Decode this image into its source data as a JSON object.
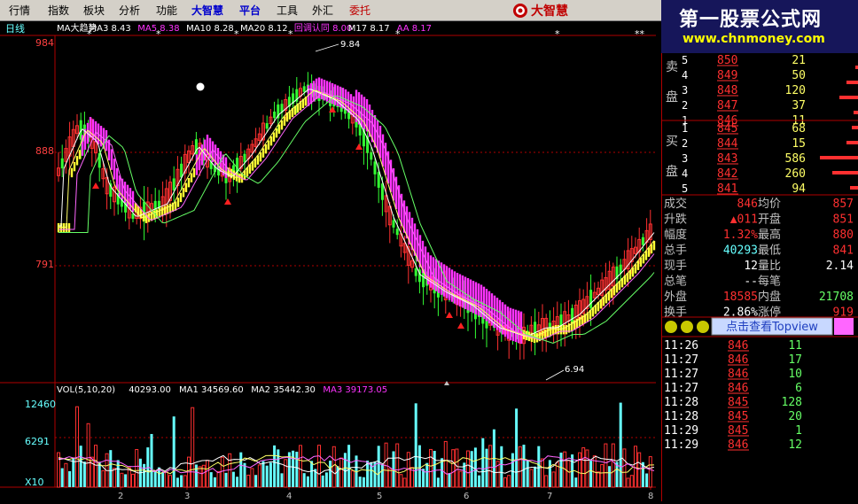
{
  "menu": {
    "items": [
      "行情",
      "指数",
      "板块",
      "分析",
      "功能",
      "大智慧",
      "平台",
      "工具",
      "外汇",
      "委托"
    ],
    "logo_text": "大智慧"
  },
  "banner": {
    "title": "第一股票公式网",
    "url": "www.chnmoney.com"
  },
  "chart": {
    "period_label": "日线",
    "indicator_line": [
      "MA大趋势",
      "MA3 8.43",
      "MA5 8.38",
      "MA10 8.28",
      "MA20 8.12",
      "回调认同 8.00",
      "M17 8.17",
      "AA 8.17"
    ],
    "price_ticks": [
      "984",
      "888",
      "791"
    ],
    "high_label": "9.84",
    "low_label": "6.94",
    "volume_line": [
      "VOL(5,10,20)",
      "40293.00",
      "MA1 34569.60",
      "MA2 35442.30",
      "MA3 39173.05"
    ],
    "volume_ticks": [
      "12460",
      "6291",
      "X10"
    ],
    "x_labels": [
      "2",
      "3",
      "4",
      "5",
      "6",
      "7",
      "8"
    ],
    "colors": {
      "up": "#ff3030",
      "down": "#33ff33",
      "magenta": "#ff33ff",
      "yellow": "#ffff33",
      "grid": "#b00000"
    }
  },
  "order_book": {
    "sell_label": [
      "卖",
      "盘"
    ],
    "buy_label": [
      "买",
      "盘"
    ],
    "sell": [
      {
        "level": "5",
        "price": "850",
        "vol": "21"
      },
      {
        "level": "4",
        "price": "849",
        "vol": "50"
      },
      {
        "level": "3",
        "price": "848",
        "vol": "120"
      },
      {
        "level": "2",
        "price": "847",
        "vol": "37"
      },
      {
        "level": "1",
        "price": "846",
        "vol": "11"
      }
    ],
    "buy": [
      {
        "level": "1",
        "price": "845",
        "vol": "68"
      },
      {
        "level": "2",
        "price": "844",
        "vol": "15"
      },
      {
        "level": "3",
        "price": "843",
        "vol": "586"
      },
      {
        "level": "4",
        "price": "842",
        "vol": "260"
      },
      {
        "level": "5",
        "price": "841",
        "vol": "94"
      }
    ]
  },
  "quote": {
    "rows": [
      {
        "l1": "成交",
        "v1": "846",
        "l2": "均价",
        "v2": "857"
      },
      {
        "l1": "升跌",
        "v1": "▲011",
        "l2": "开盘",
        "v2": "851"
      },
      {
        "l1": "幅度",
        "v1": "1.32%",
        "l2": "最高",
        "v2": "880"
      },
      {
        "l1": "总手",
        "v1": "40293",
        "l2": "最低",
        "v2": "841"
      },
      {
        "l1": "现手",
        "v1": "12",
        "l2": "量比",
        "v2": "2.14"
      },
      {
        "l1": "总笔",
        "v1": "--",
        "l2": "每笔",
        "v2": ""
      },
      {
        "l1": "外盘",
        "v1": "18585",
        "l2": "内盘",
        "v2": "21708"
      },
      {
        "l1": "换手",
        "v1": "2.86%",
        "l2": "涨停",
        "v2": "919"
      }
    ]
  },
  "topview_label": "点击查看Topview",
  "ticks": [
    {
      "time": "11:26",
      "price": "846",
      "vol": "11"
    },
    {
      "time": "11:27",
      "price": "846",
      "vol": "17"
    },
    {
      "time": "11:27",
      "price": "846",
      "vol": "10"
    },
    {
      "time": "11:27",
      "price": "846",
      "vol": "6"
    },
    {
      "time": "11:28",
      "price": "845",
      "vol": "128"
    },
    {
      "time": "11:28",
      "price": "845",
      "vol": "20"
    },
    {
      "time": "11:29",
      "price": "845",
      "vol": "1"
    },
    {
      "time": "11:29",
      "price": "846",
      "vol": "12"
    }
  ]
}
